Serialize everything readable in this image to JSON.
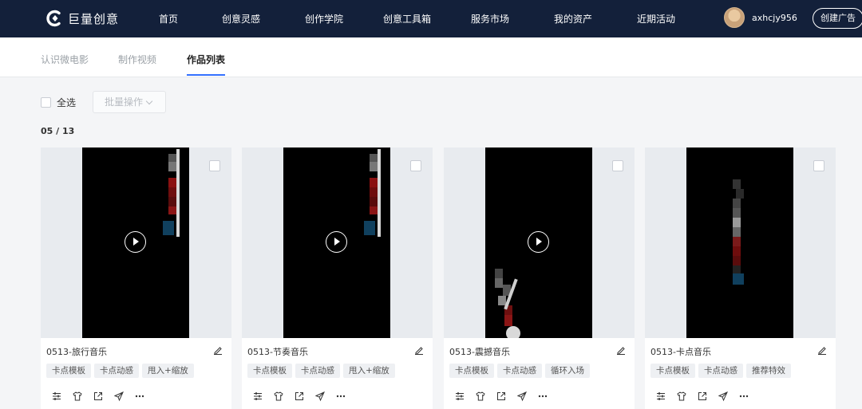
{
  "brand": {
    "name": "巨量创意"
  },
  "nav": {
    "items": [
      {
        "label": "首页"
      },
      {
        "label": "创意灵感"
      },
      {
        "label": "创作学院"
      },
      {
        "label": "创意工具箱"
      },
      {
        "label": "服务市场"
      },
      {
        "label": "我的资产"
      },
      {
        "label": "近期活动"
      }
    ],
    "username": "axhcjy956",
    "create_ad_label": "创建广告"
  },
  "subnav": {
    "tabs": [
      {
        "label": "认识微电影"
      },
      {
        "label": "制作视频"
      },
      {
        "label": "作品列表",
        "active": true
      }
    ]
  },
  "toolbar": {
    "select_all_label": "全选",
    "batch_label": "批量操作"
  },
  "counter": "05 / 13",
  "cards": [
    {
      "title": "0513-旅行音乐",
      "tags": [
        "卡点模板",
        "卡点动感",
        "甩入+缩放"
      ]
    },
    {
      "title": "0513-节奏音乐",
      "tags": [
        "卡点模板",
        "卡点动感",
        "甩入+缩放"
      ]
    },
    {
      "title": "0513-震撼音乐",
      "tags": [
        "卡点模板",
        "卡点动感",
        "循环入场"
      ]
    },
    {
      "title": "0513-卡点音乐",
      "tags": [
        "卡点模板",
        "卡点动感",
        "推荐特效"
      ]
    }
  ],
  "icons": {
    "card_actions": [
      "sliders-icon",
      "shirt-icon",
      "external-link-icon",
      "send-icon",
      "more-icon"
    ],
    "edit": "pencil-icon",
    "play": "play-icon"
  },
  "colors": {
    "nav_bg": "#13203a",
    "accent": "#3370ff",
    "tag_bg": "#eef0f3"
  }
}
